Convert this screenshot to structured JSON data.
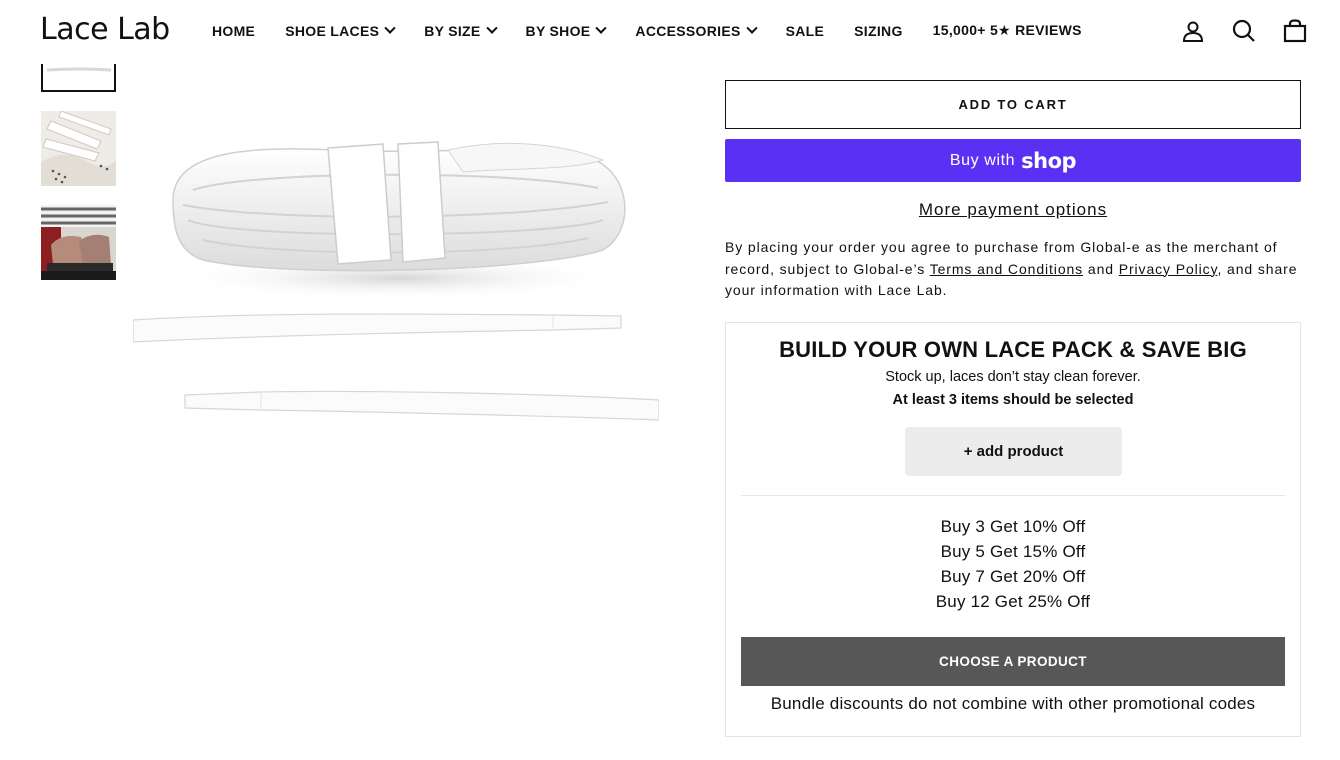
{
  "header": {
    "logo": "Lace Lab",
    "nav": [
      {
        "label": "HOME",
        "dropdown": false
      },
      {
        "label": "SHOE LACES",
        "dropdown": true
      },
      {
        "label": "BY SIZE",
        "dropdown": true
      },
      {
        "label": "BY SHOE",
        "dropdown": true
      },
      {
        "label": "ACCESSORIES",
        "dropdown": true
      },
      {
        "label": "SALE",
        "dropdown": false
      },
      {
        "label": "SIZING",
        "dropdown": false
      },
      {
        "label": "15,000+ 5★ REVIEWS",
        "dropdown": false
      }
    ],
    "icons": [
      "account-icon",
      "search-icon",
      "cart-icon"
    ]
  },
  "gallery": {
    "thumbnails": [
      "white-laces-thumbnail",
      "sneaker-laces-thumbnail",
      "worn-sneaker-thumbnail"
    ]
  },
  "purchase": {
    "add_to_cart": "ADD TO CART",
    "buy_with": "Buy with",
    "shop_brand": "shop",
    "more_payment": "More payment options",
    "legal_1": "By placing your order you agree to purchase from Global-e as the merchant of record, subject to Global-e’s ",
    "terms_link": "Terms and Conditions",
    "legal_2": " and ",
    "privacy_link": "Privacy Policy",
    "legal_3": ", and share your information with Lace Lab."
  },
  "bundle": {
    "title": "BUILD YOUR OWN LACE PACK & SAVE BIG",
    "subtitle": "Stock up, laces don’t stay clean forever.",
    "requirement": "At least 3 items should be selected",
    "add_product": "+ add product",
    "tiers": [
      "Buy 3 Get 10% Off",
      "Buy 5 Get 15% Off",
      "Buy 7 Get 20% Off",
      "Buy 12 Get 25% Off"
    ],
    "choose_button": "CHOOSE A PRODUCT",
    "note": "Bundle discounts do not combine with other promotional codes"
  },
  "colors": {
    "shop_pay": "#5a31f4",
    "choose_button": "#575757",
    "add_product_bg": "#ececec"
  }
}
